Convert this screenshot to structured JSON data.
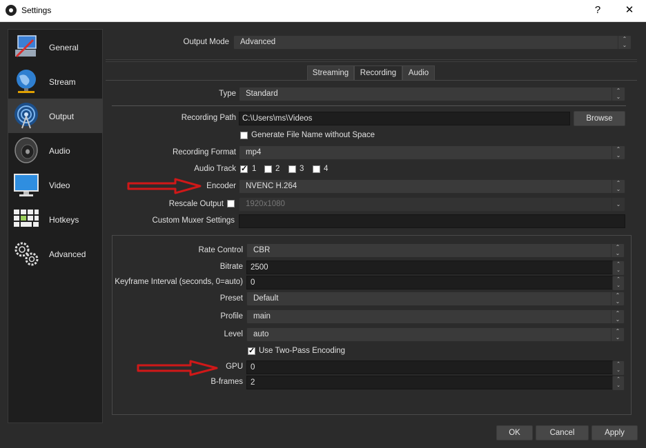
{
  "window": {
    "title": "Settings",
    "help_glyph": "?",
    "close_glyph": "✕"
  },
  "sidebar": {
    "items": [
      {
        "label": "General",
        "icon": "general-icon"
      },
      {
        "label": "Stream",
        "icon": "stream-globe-icon"
      },
      {
        "label": "Output",
        "icon": "output-antenna-icon",
        "active": true
      },
      {
        "label": "Audio",
        "icon": "speaker-icon"
      },
      {
        "label": "Video",
        "icon": "monitor-icon"
      },
      {
        "label": "Hotkeys",
        "icon": "keyboard-icon"
      },
      {
        "label": "Advanced",
        "icon": "gears-icon"
      }
    ]
  },
  "output_mode": {
    "label": "Output Mode",
    "value": "Advanced"
  },
  "tabs": [
    {
      "label": "Streaming"
    },
    {
      "label": "Recording",
      "active": true
    },
    {
      "label": "Audio"
    }
  ],
  "recording": {
    "type": {
      "label": "Type",
      "value": "Standard"
    },
    "path": {
      "label": "Recording Path",
      "value": "C:\\Users\\ms\\Videos",
      "browse_label": "Browse"
    },
    "gen_filename": {
      "label": "Generate File Name without Space",
      "checked": false
    },
    "format": {
      "label": "Recording Format",
      "value": "mp4"
    },
    "audio_track": {
      "label": "Audio Track",
      "tracks": [
        {
          "label": "1",
          "checked": true
        },
        {
          "label": "2",
          "checked": false
        },
        {
          "label": "3",
          "checked": false
        },
        {
          "label": "4",
          "checked": false
        }
      ]
    },
    "encoder": {
      "label": "Encoder",
      "value": "NVENC H.264"
    },
    "rescale": {
      "label": "Rescale Output",
      "checked": false,
      "value": "1920x1080"
    },
    "muxer": {
      "label": "Custom Muxer Settings",
      "value": ""
    }
  },
  "encoder_settings": {
    "rate_control": {
      "label": "Rate Control",
      "value": "CBR"
    },
    "bitrate": {
      "label": "Bitrate",
      "value": "2500"
    },
    "keyframe": {
      "label": "Keyframe Interval (seconds, 0=auto)",
      "value": "0"
    },
    "preset": {
      "label": "Preset",
      "value": "Default"
    },
    "profile": {
      "label": "Profile",
      "value": "main"
    },
    "level": {
      "label": "Level",
      "value": "auto"
    },
    "two_pass": {
      "label": "Use Two-Pass Encoding",
      "checked": true
    },
    "gpu": {
      "label": "GPU",
      "value": "0"
    },
    "bframes": {
      "label": "B-frames",
      "value": "2"
    }
  },
  "footer": {
    "ok_label": "OK",
    "cancel_label": "Cancel",
    "apply_label": "Apply"
  },
  "colors": {
    "annotation_arrow": "#d01818",
    "background": "#2b2b2b",
    "sidebar_bg": "#1e1e1e"
  }
}
